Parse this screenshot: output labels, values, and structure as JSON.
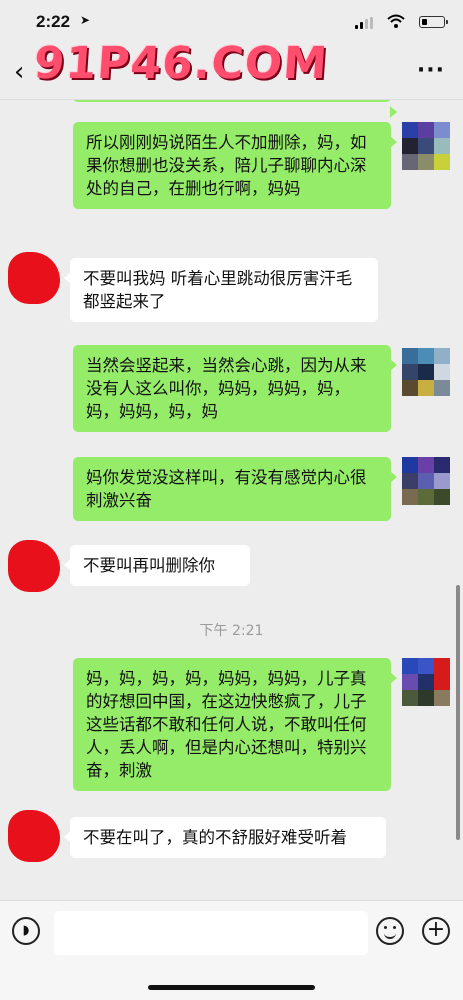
{
  "status_bar": {
    "time": "2:22"
  },
  "watermark": {
    "text": "91P46.COM"
  },
  "nav": {
    "back_symbol": "‹",
    "more_symbol": "···"
  },
  "messages": [
    {
      "side": "out",
      "text": "所以刚刚妈说陌生人不加删除，妈，如果你想删也没关系，陪儿子聊聊内心深处的自己，在删也行啊，妈妈"
    },
    {
      "side": "in",
      "text": "不要叫我妈 听着心里跳动很厉害汗毛都竖起来了"
    },
    {
      "side": "out",
      "text": "当然会竖起来，当然会心跳，因为从来没有人这么叫你，妈妈，妈妈，妈，妈，妈妈，妈，妈"
    },
    {
      "side": "out",
      "text": "妈你发觉没这样叫，有没有感觉内心很刺激兴奋"
    },
    {
      "side": "in",
      "text": "不要叫再叫删除你"
    },
    {
      "side": "out",
      "text": "妈，妈，妈，妈，妈妈，妈妈，儿子真的好想回中国，在这边快憋疯了，儿子这些话都不敢和任何人说，不敢叫任何人，丢人啊，但是内心还想叫，特别兴奋，刺激"
    },
    {
      "side": "in",
      "text": "不要在叫了，真的不舒服好难受听着"
    }
  ],
  "timestamp": "下午 2:21",
  "colors": {
    "out_bubble": "#95ec69",
    "in_bubble": "#ffffff",
    "background": "#ededed"
  }
}
